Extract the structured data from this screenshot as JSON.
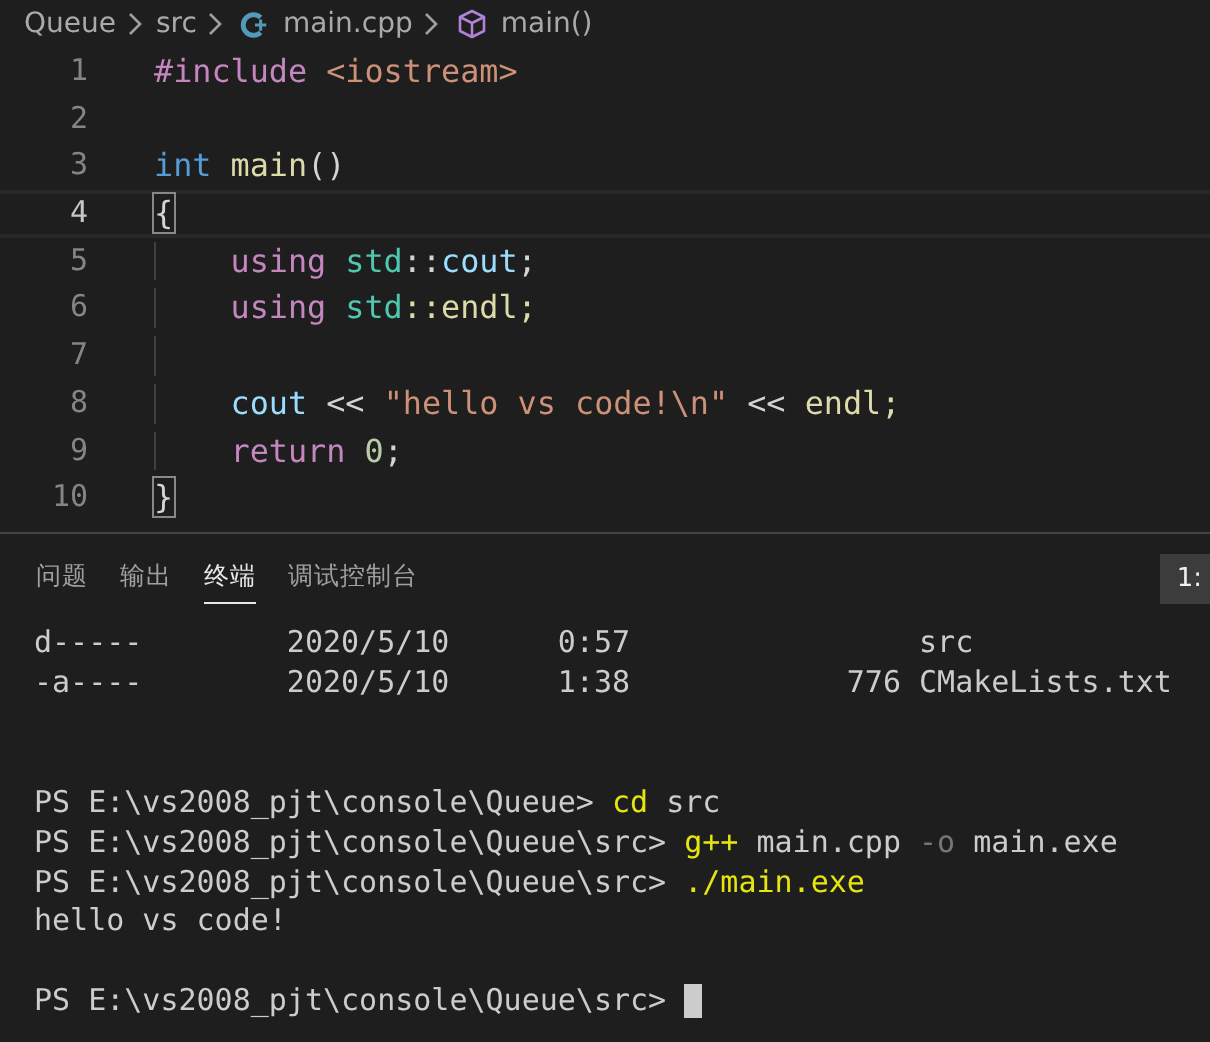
{
  "breadcrumb": [
    {
      "label": "Queue",
      "kind": "folder"
    },
    {
      "label": "src",
      "kind": "folder"
    },
    {
      "label": "main.cpp",
      "kind": "file"
    },
    {
      "label": "main()",
      "kind": "symbol"
    }
  ],
  "editor": {
    "lines": [
      {
        "number": "1",
        "current": false,
        "tokens": [
          {
            "text": "#include ",
            "kind": "keyword"
          },
          {
            "text": "<iostream>",
            "kind": "string"
          }
        ]
      },
      {
        "number": "2",
        "current": false
      },
      {
        "number": "3",
        "current": false,
        "tokens": [
          {
            "text": "int ",
            "kind": "type"
          },
          {
            "text": "main",
            "kind": "function"
          },
          {
            "text": "()",
            "kind": "plain"
          }
        ]
      },
      {
        "number": "4",
        "current": true,
        "tokens": [
          {
            "text": "{",
            "kind": "bracket-match"
          }
        ]
      },
      {
        "number": "5",
        "current": false,
        "tokens": [
          {
            "text": "    using ",
            "kind": "keyword"
          },
          {
            "text": "std",
            "kind": "namespace"
          },
          {
            "text": "::",
            "kind": "plain"
          },
          {
            "text": "cout",
            "kind": "variable"
          },
          {
            "text": ";",
            "kind": "plain"
          }
        ]
      },
      {
        "number": "6",
        "current": false,
        "tokens": [
          {
            "text": "    using ",
            "kind": "keyword"
          },
          {
            "text": "std",
            "kind": "namespace"
          },
          {
            "text": "::endl;",
            "kind": "function"
          }
        ]
      },
      {
        "number": "7",
        "current": false
      },
      {
        "number": "8",
        "current": false,
        "tokens": [
          {
            "text": "    cout",
            "kind": "variable"
          },
          {
            "text": " << ",
            "kind": "plain"
          },
          {
            "text": "\"hello vs code!\\n\"",
            "kind": "string"
          },
          {
            "text": " << ",
            "kind": "plain"
          },
          {
            "text": "endl;",
            "kind": "function"
          }
        ]
      },
      {
        "number": "9",
        "current": false,
        "tokens": [
          {
            "text": "    return ",
            "kind": "keyword"
          },
          {
            "text": "0",
            "kind": "number"
          },
          {
            "text": ";",
            "kind": "plain"
          }
        ]
      },
      {
        "number": "10",
        "current": false,
        "tokens": [
          {
            "text": "}",
            "kind": "bracket-match"
          }
        ]
      }
    ]
  },
  "panel": {
    "tabs": [
      {
        "label": "问题",
        "selected": false
      },
      {
        "label": "输出",
        "selected": false
      },
      {
        "label": "终端",
        "selected": true
      },
      {
        "label": "调试控制台",
        "selected": false
      }
    ],
    "terminal_selector": "1:",
    "terminal": {
      "listing": [
        [
          {
            "text": "d-----        2020/5/10      0:57                src",
            "kind": "plain"
          }
        ],
        [
          {
            "text": "-a----        2020/5/10      1:38            776 CMakeLists.txt",
            "kind": "plain"
          }
        ]
      ],
      "session": [
        [
          {
            "text": "PS E:\\vs2008_pjt\\console\\Queue> ",
            "kind": "plain"
          },
          {
            "text": "cd",
            "kind": "command"
          },
          {
            "text": " src",
            "kind": "plain"
          }
        ],
        [
          {
            "text": "PS E:\\vs2008_pjt\\console\\Queue\\src> ",
            "kind": "plain"
          },
          {
            "text": "g++",
            "kind": "command"
          },
          {
            "text": " main.cpp ",
            "kind": "plain"
          },
          {
            "text": "-o",
            "kind": "flag"
          },
          {
            "text": " main.exe",
            "kind": "plain"
          }
        ],
        [
          {
            "text": "PS E:\\vs2008_pjt\\console\\Queue\\src> ",
            "kind": "plain"
          },
          {
            "text": "./main.exe",
            "kind": "command"
          }
        ],
        [
          {
            "text": "hello vs code!",
            "kind": "plain"
          }
        ]
      ],
      "prompt": {
        "text": "PS E:\\vs2008_pjt\\console\\Queue\\src> ",
        "cursor": true
      }
    }
  }
}
